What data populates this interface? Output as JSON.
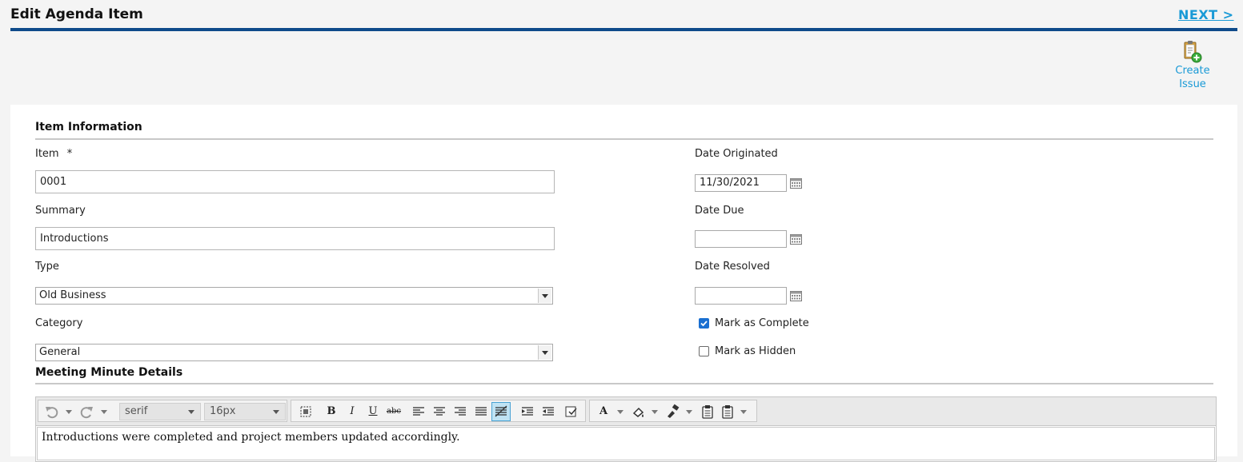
{
  "header": {
    "title": "Edit Agenda Item",
    "next_label": "NEXT >"
  },
  "actions": {
    "create_issue_line1": "Create",
    "create_issue_line2": "Issue"
  },
  "item_information": {
    "section_title": "Item Information",
    "item_label": "Item",
    "required_marker": "*",
    "item_value": "0001",
    "summary_label": "Summary",
    "summary_value": "Introductions",
    "type_label": "Type",
    "type_value": "Old Business",
    "category_label": "Category",
    "category_value": "General",
    "date_originated_label": "Date Originated",
    "date_originated_value": "11/30/2021",
    "date_due_label": "Date Due",
    "date_due_value": "",
    "date_resolved_label": "Date Resolved",
    "date_resolved_value": "",
    "mark_complete_label": "Mark as Complete",
    "mark_complete_checked": true,
    "mark_hidden_label": "Mark as Hidden",
    "mark_hidden_checked": false
  },
  "meeting_minutes": {
    "section_title": "Meeting Minute Details",
    "font_family_value": "serif",
    "font_size_value": "16px",
    "content": "Introductions were completed and project members updated accordingly."
  },
  "colors": {
    "header_rule": "#0e4a8a",
    "link": "#1a9ad6",
    "checkbox_checked": "#1a6fd1"
  }
}
